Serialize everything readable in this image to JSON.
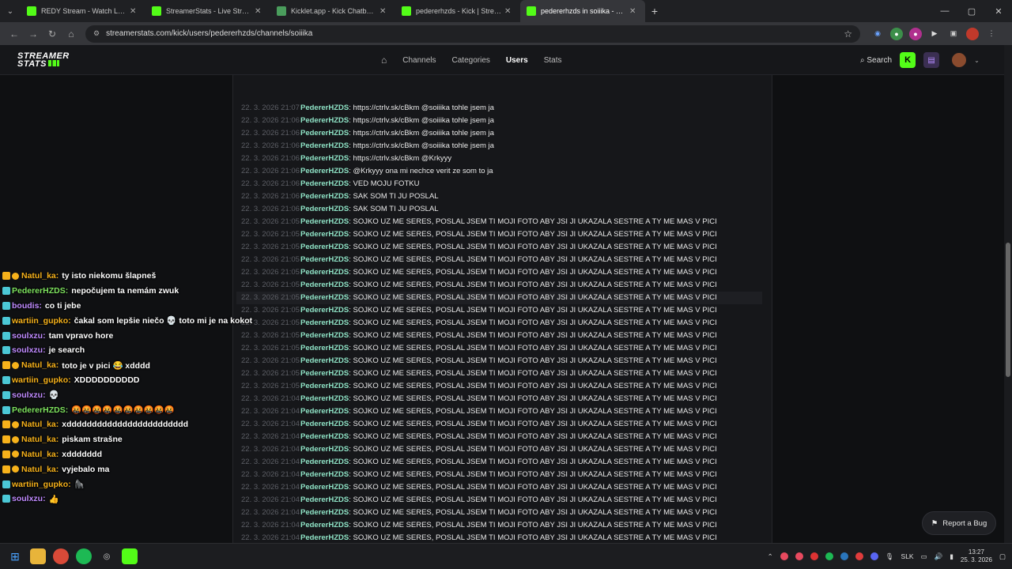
{
  "browser": {
    "tabs": [
      {
        "label": "REDY Stream - Watch Live on K",
        "color": "#53fc18",
        "active": false
      },
      {
        "label": "StreamerStats - Live Streaming",
        "color": "#53fc18",
        "active": false
      },
      {
        "label": "Kicklet.app - Kick Chatbot and",
        "color": "#4a9d5c",
        "active": false
      },
      {
        "label": "pedererhzds - Kick | StreamerSt",
        "color": "#53fc18",
        "active": false
      },
      {
        "label": "pedererhzds in soiiika - Kick | St",
        "color": "#53fc18",
        "active": true
      }
    ],
    "url": "streamerstats.com/kick/users/pedererhzds/channels/soiiika"
  },
  "site": {
    "logo_line1": "STREAMER",
    "logo_line2": "STATS",
    "nav": {
      "channels": "Channels",
      "categories": "Categories",
      "users": "Users",
      "stats": "Stats"
    },
    "search": "Search",
    "report_bug": "Report a Bug"
  },
  "log": {
    "user": "PedererHZDS",
    "rows": [
      {
        "ts": "22. 3. 2026 21:07",
        "msg": "https://ctrlv.sk/cBkm @soiiika tohle jsem ja"
      },
      {
        "ts": "22. 3. 2026 21:06",
        "msg": "https://ctrlv.sk/cBkm @soiiika tohle jsem ja"
      },
      {
        "ts": "22. 3. 2026 21:06",
        "msg": "https://ctrlv.sk/cBkm @soiiika tohle jsem ja"
      },
      {
        "ts": "22. 3. 2026 21:06",
        "msg": "https://ctrlv.sk/cBkm @soiiika tohle jsem ja"
      },
      {
        "ts": "22. 3. 2026 21:06",
        "msg": "https://ctrlv.sk/cBkm @Krkyyy"
      },
      {
        "ts": "22. 3. 2026 21:06",
        "msg": "@Krkyyy ona mi nechce verit ze som to ja"
      },
      {
        "ts": "22. 3. 2026 21:06",
        "msg": "VED MOJU FOTKU"
      },
      {
        "ts": "22. 3. 2026 21:06",
        "msg": "SAK SOM TI JU POSLAL"
      },
      {
        "ts": "22. 3. 2026 21:06",
        "msg": "SAK SOM TI JU POSLAL"
      },
      {
        "ts": "22. 3. 2026 21:05",
        "msg": "SOJKO UZ ME SERES, POSLAL JSEM TI MOJI FOTO ABY JSI JI UKAZALA SESTRE A TY ME MAS V PICI"
      },
      {
        "ts": "22. 3. 2026 21:05",
        "msg": "SOJKO UZ ME SERES, POSLAL JSEM TI MOJI FOTO ABY JSI JI UKAZALA SESTRE A TY ME MAS V PICI"
      },
      {
        "ts": "22. 3. 2026 21:05",
        "msg": "SOJKO UZ ME SERES, POSLAL JSEM TI MOJI FOTO ABY JSI JI UKAZALA SESTRE A TY ME MAS V PICI"
      },
      {
        "ts": "22. 3. 2026 21:05",
        "msg": "SOJKO UZ ME SERES, POSLAL JSEM TI MOJI FOTO ABY JSI JI UKAZALA SESTRE A TY ME MAS V PICI"
      },
      {
        "ts": "22. 3. 2026 21:05",
        "msg": "SOJKO UZ ME SERES, POSLAL JSEM TI MOJI FOTO ABY JSI JI UKAZALA SESTRE A TY ME MAS V PICI"
      },
      {
        "ts": "22. 3. 2026 21:05",
        "msg": "SOJKO UZ ME SERES, POSLAL JSEM TI MOJI FOTO ABY JSI JI UKAZALA SESTRE A TY ME MAS V PICI"
      },
      {
        "ts": "22. 3. 2026 21:05",
        "msg": "SOJKO UZ ME SERES, POSLAL JSEM TI MOJI FOTO ABY JSI JI UKAZALA SESTRE A TY ME MAS V PICI",
        "highlight": true
      },
      {
        "ts": "22. 3. 2026 21:05",
        "msg": "SOJKO UZ ME SERES, POSLAL JSEM TI MOJI FOTO ABY JSI JI UKAZALA SESTRE A TY ME MAS V PICI"
      },
      {
        "ts": "22. 3. 2026 21:05",
        "msg": "SOJKO UZ ME SERES, POSLAL JSEM TI MOJI FOTO ABY JSI JI UKAZALA SESTRE A TY ME MAS V PICI"
      },
      {
        "ts": "22. 3. 2026 21:05",
        "msg": "SOJKO UZ ME SERES, POSLAL JSEM TI MOJI FOTO ABY JSI JI UKAZALA SESTRE A TY ME MAS V PICI"
      },
      {
        "ts": "22. 3. 2026 21:05",
        "msg": "SOJKO UZ ME SERES, POSLAL JSEM TI MOJI FOTO ABY JSI JI UKAZALA SESTRE A TY ME MAS V PICI"
      },
      {
        "ts": "22. 3. 2026 21:05",
        "msg": "SOJKO UZ ME SERES, POSLAL JSEM TI MOJI FOTO ABY JSI JI UKAZALA SESTRE A TY ME MAS V PICI"
      },
      {
        "ts": "22. 3. 2026 21:05",
        "msg": "SOJKO UZ ME SERES, POSLAL JSEM TI MOJI FOTO ABY JSI JI UKAZALA SESTRE A TY ME MAS V PICI"
      },
      {
        "ts": "22. 3. 2026 21:05",
        "msg": "SOJKO UZ ME SERES, POSLAL JSEM TI MOJI FOTO ABY JSI JI UKAZALA SESTRE A TY ME MAS V PICI"
      },
      {
        "ts": "22. 3. 2026 21:04",
        "msg": "SOJKO UZ ME SERES, POSLAL JSEM TI MOJI FOTO ABY JSI JI UKAZALA SESTRE A TY ME MAS V PICI"
      },
      {
        "ts": "22. 3. 2026 21:04",
        "msg": "SOJKO UZ ME SERES, POSLAL JSEM TI MOJI FOTO ABY JSI JI UKAZALA SESTRE A TY ME MAS V PICI"
      },
      {
        "ts": "22. 3. 2026 21:04",
        "msg": "SOJKO UZ ME SERES, POSLAL JSEM TI MOJI FOTO ABY JSI JI UKAZALA SESTRE A TY ME MAS V PICI"
      },
      {
        "ts": "22. 3. 2026 21:04",
        "msg": "SOJKO UZ ME SERES, POSLAL JSEM TI MOJI FOTO ABY JSI JI UKAZALA SESTRE A TY ME MAS V PICI"
      },
      {
        "ts": "22. 3. 2026 21:04",
        "msg": "SOJKO UZ ME SERES, POSLAL JSEM TI MOJI FOTO ABY JSI JI UKAZALA SESTRE A TY ME MAS V PICI"
      },
      {
        "ts": "22. 3. 2026 21:04",
        "msg": "SOJKO UZ ME SERES, POSLAL JSEM TI MOJI FOTO ABY JSI JI UKAZALA SESTRE A TY ME MAS V PICI"
      },
      {
        "ts": "22. 3. 2026 21:04",
        "msg": "SOJKO UZ ME SERES, POSLAL JSEM TI MOJI FOTO ABY JSI JI UKAZALA SESTRE A TY ME MAS V PICI"
      },
      {
        "ts": "22. 3. 2026 21:04",
        "msg": "SOJKO UZ ME SERES, POSLAL JSEM TI MOJI FOTO ABY JSI JI UKAZALA SESTRE A TY ME MAS V PICI"
      },
      {
        "ts": "22. 3. 2026 21:04",
        "msg": "SOJKO UZ ME SERES, POSLAL JSEM TI MOJI FOTO ABY JSI JI UKAZALA SESTRE A TY ME MAS V PICI"
      },
      {
        "ts": "22. 3. 2026 21:04",
        "msg": "SOJKO UZ ME SERES, POSLAL JSEM TI MOJI FOTO ABY JSI JI UKAZALA SESTRE A TY ME MAS V PICI"
      },
      {
        "ts": "22. 3. 2026 21:04",
        "msg": "SOJKO UZ ME SERES, POSLAL JSEM TI MOJI FOTO ABY JSI JI UKAZALA SESTRE A TY ME MAS V PICI"
      },
      {
        "ts": "22. 3. 2026 21:04",
        "msg": "SOJKO UZ ME SERES, POSLAL JSEM TI MOJI FOTO ABY JSI JI UKAZALA SESTRE A TY ME MAS V PICI"
      },
      {
        "ts": "22. 3. 2026 21:04",
        "msg": "SOJKO UZ ME SERES, POSLAL JSEM TI MOJI FOTO ABY JSI JI UKAZALA SESTRE A TY ME MAS V PICI"
      }
    ]
  },
  "overlay_chat": [
    {
      "name": "Natul_ka:",
      "color": "#f7b21b",
      "msg": "ty isto niekomu šlapneš",
      "badges": 2
    },
    {
      "name": "PedererHZDS:",
      "color": "#7ee35f",
      "msg": "nepočujem ta nemám zwuk",
      "badges": 1
    },
    {
      "name": "boudis:",
      "color": "#c08bff",
      "msg": "co ti jebe",
      "badges": 1
    },
    {
      "name": "wartiin_gupko:",
      "color": "#f7b21b",
      "msg": "čakal som lepšie niečo 💀 toto mi je na kokot",
      "badges": 1
    },
    {
      "name": "soulxzu:",
      "color": "#c08bff",
      "msg": "tam vpravo hore",
      "badges": 1
    },
    {
      "name": "soulxzu:",
      "color": "#c08bff",
      "msg": "je search",
      "badges": 1
    },
    {
      "name": "Natul_ka:",
      "color": "#f7b21b",
      "msg": "toto je v pici 😂 xdddd",
      "badges": 2
    },
    {
      "name": "wartiin_gupko:",
      "color": "#f7b21b",
      "msg": "XDDDDDDDDDD",
      "badges": 1
    },
    {
      "name": "soulxzu:",
      "color": "#c08bff",
      "msg": "💀",
      "badges": 1
    },
    {
      "name": "PedererHZDS:",
      "color": "#7ee35f",
      "msg": "🤬🤬🤬🤬🤬🤬🤬🤬🤬🤬",
      "badges": 1
    },
    {
      "name": "Natul_ka:",
      "color": "#f7b21b",
      "msg": "xdddddddddddddddddddddddd",
      "badges": 2
    },
    {
      "name": "Natul_ka:",
      "color": "#f7b21b",
      "msg": "piskam strašne",
      "badges": 2
    },
    {
      "name": "Natul_ka:",
      "color": "#f7b21b",
      "msg": "xddddddd",
      "badges": 2
    },
    {
      "name": "Natul_ka:",
      "color": "#f7b21b",
      "msg": "vyjebalo ma",
      "badges": 2
    },
    {
      "name": "wartiin_gupko:",
      "color": "#f7b21b",
      "msg": "🦍",
      "badges": 1
    },
    {
      "name": "soulxzu:",
      "color": "#c08bff",
      "msg": "👍",
      "badges": 1
    }
  ],
  "taskbar": {
    "lang": "SLK",
    "time": "13:27",
    "date": "25. 3. 2026"
  },
  "colors": {
    "accent": "#53fc18",
    "username": "#8fe3c6"
  }
}
